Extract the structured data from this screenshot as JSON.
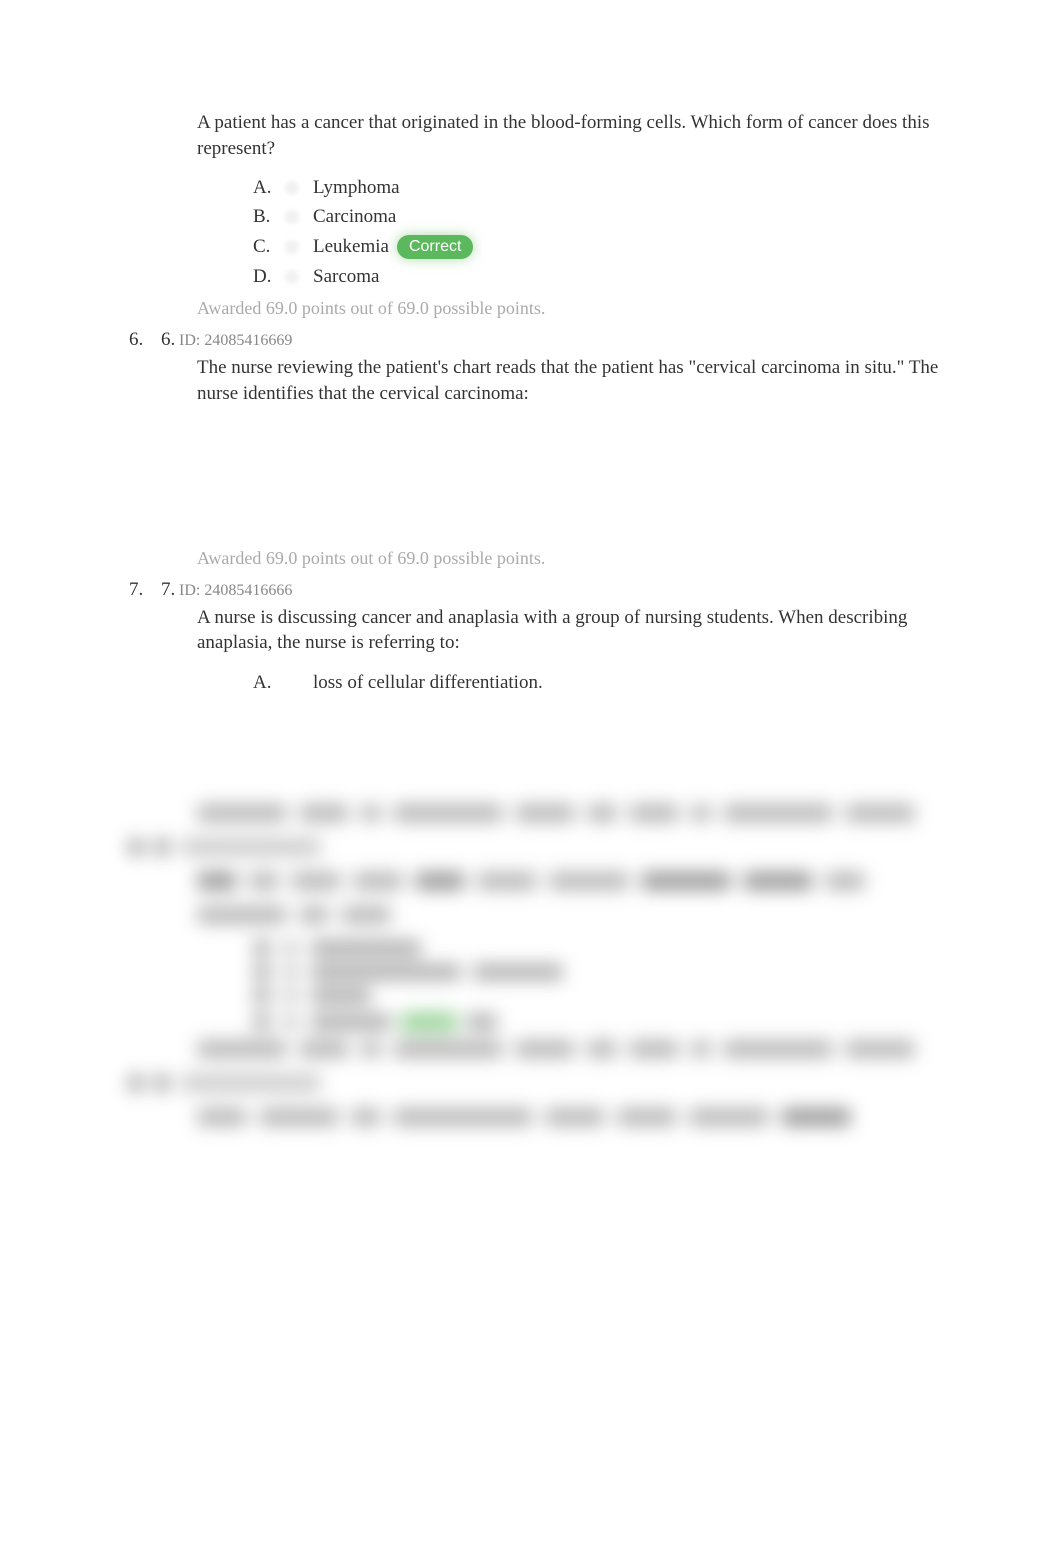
{
  "q5": {
    "text": "A patient has a cancer that originated in the blood-forming cells. Which form of cancer does this represent?",
    "choices": [
      {
        "letter": "A.",
        "text": "Lymphoma",
        "correct": false
      },
      {
        "letter": "B.",
        "text": "Carcinoma",
        "correct": false
      },
      {
        "letter": "C.",
        "text": "Leukemia",
        "correct": true
      },
      {
        "letter": "D.",
        "text": "Sarcoma",
        "correct": false
      }
    ],
    "points": "Awarded 69.0 points out of 69.0 possible points."
  },
  "q6": {
    "num_outer": "6.",
    "num_inner": "6.",
    "id": "ID: 24085416669",
    "text": "The nurse reviewing the patient's chart reads that the patient has \"cervical carcinoma in situ.\" The nurse identifies that the cervical carcinoma:",
    "points": "Awarded 69.0 points out of 69.0 possible points."
  },
  "q7": {
    "num_outer": "7.",
    "num_inner": "7.",
    "id": "ID: 24085416666",
    "text": "A nurse is discussing cancer and anaplasia with a group of nursing students. When describing anaplasia, the nurse is referring to:",
    "choices": [
      {
        "letter": "A.",
        "text": "loss of cellular differentiation."
      }
    ]
  },
  "correct_label": "Correct"
}
